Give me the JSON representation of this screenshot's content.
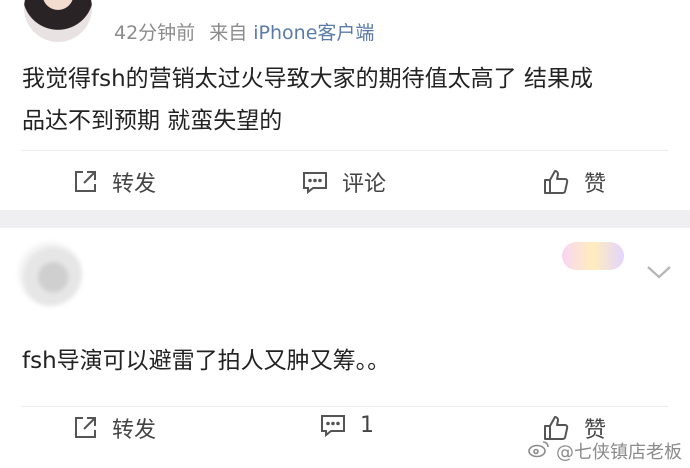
{
  "post1": {
    "author_name": "",
    "time": "42分钟前",
    "source_prefix": "来自",
    "source": "iPhone客户端",
    "content_line1": "我觉得fsh的营销太过火导致大家的期待值太高了 结果成",
    "content_line2": "品达不到预期 就蛮失望的",
    "actions": {
      "forward": "转发",
      "comment": "评论",
      "like": "赞"
    }
  },
  "post2": {
    "author_name": "",
    "meta": "",
    "content": "fsh导演可以避雷了拍人又肿又筹。。",
    "actions": {
      "forward": "转发",
      "comment_count": "1",
      "like": "赞"
    }
  },
  "watermark": "@七侠镇店老板",
  "colors": {
    "separator": "#efeff1",
    "source_link": "#5b7ba8",
    "text": "#222222"
  }
}
